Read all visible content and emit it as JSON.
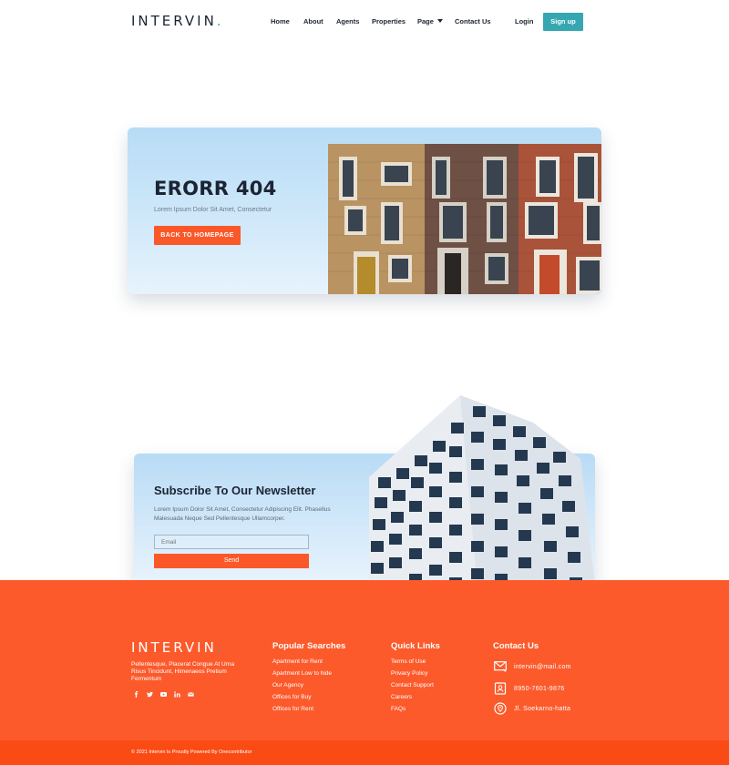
{
  "brand": {
    "name": "INTERVIN",
    "dot": ".",
    "accent": "#2bb3b1",
    "primary": "#fb5829"
  },
  "nav": {
    "home": "Home",
    "about": "About",
    "agents": "Agents",
    "properties": "Properties",
    "page": "Page",
    "contact": "Contact Us",
    "login": "Login",
    "signup": "Sign up"
  },
  "error": {
    "title": "ERORR 404",
    "subtitle": "Lorem Ipsum Dolor Sit Amet, Consectetur",
    "button": "BACK TO HOMEPAGE"
  },
  "newsletter": {
    "title": "Subscribe To Our Newsletter",
    "text": "Lorem Ipsum Dolor Sit Amet, Consectetur Adipiscing Elit. Phasellus Malesuada Neque Sed Pellentesque Ullamcorper.",
    "email_placeholder": "Email",
    "send": "Send"
  },
  "footer": {
    "description": "Pellentesque, Placerat Congue At Urna Risus Tincidunt, Himenaeos Pretium Fermentum",
    "social_icons": [
      "facebook-icon",
      "twitter-icon",
      "youtube-icon",
      "linkedin-icon",
      "mail-icon"
    ],
    "popular": {
      "title": "Popular Searches",
      "items": [
        "Apartment for Rent",
        "Apartment Low to hide",
        "Our Agency",
        "Offices for Buy",
        "Offices for Rent"
      ]
    },
    "quick": {
      "title": "Quick Links",
      "items": [
        "Terms of Use",
        "Privacy Policy",
        "Contact Support",
        "Careers",
        "FAQs"
      ]
    },
    "contact": {
      "title": "Contact Us",
      "email": "intervin@mail.com",
      "phone": "8950-7601-9876",
      "address": "Jl. Soekarno-hatta"
    },
    "copyright": "© 2021 Intervin Is Proudly Powered By Onecontributor"
  }
}
